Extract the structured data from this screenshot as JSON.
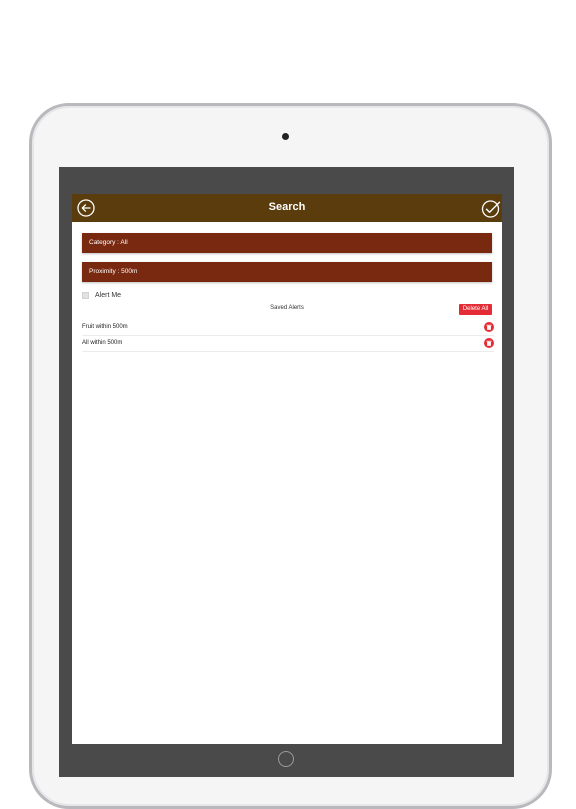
{
  "navbar": {
    "title": "Search",
    "back_icon": "back-arrow-icon",
    "done_icon": "checkmark-icon",
    "color": "#5b3c0c"
  },
  "filters": {
    "category": "Category : All",
    "proximity": "Proximity : 500m",
    "bar_color": "#78290f"
  },
  "alert_me": {
    "label": "Alert Me",
    "checked": false
  },
  "saved_alerts": {
    "title": "Saved Alerts",
    "delete_all_label": "Delete All",
    "delete_color": "#e42c36",
    "items": [
      {
        "label": "Fruit within 500m",
        "icon": "trash-icon"
      },
      {
        "label": "All within 500m",
        "icon": "trash-icon"
      }
    ]
  }
}
